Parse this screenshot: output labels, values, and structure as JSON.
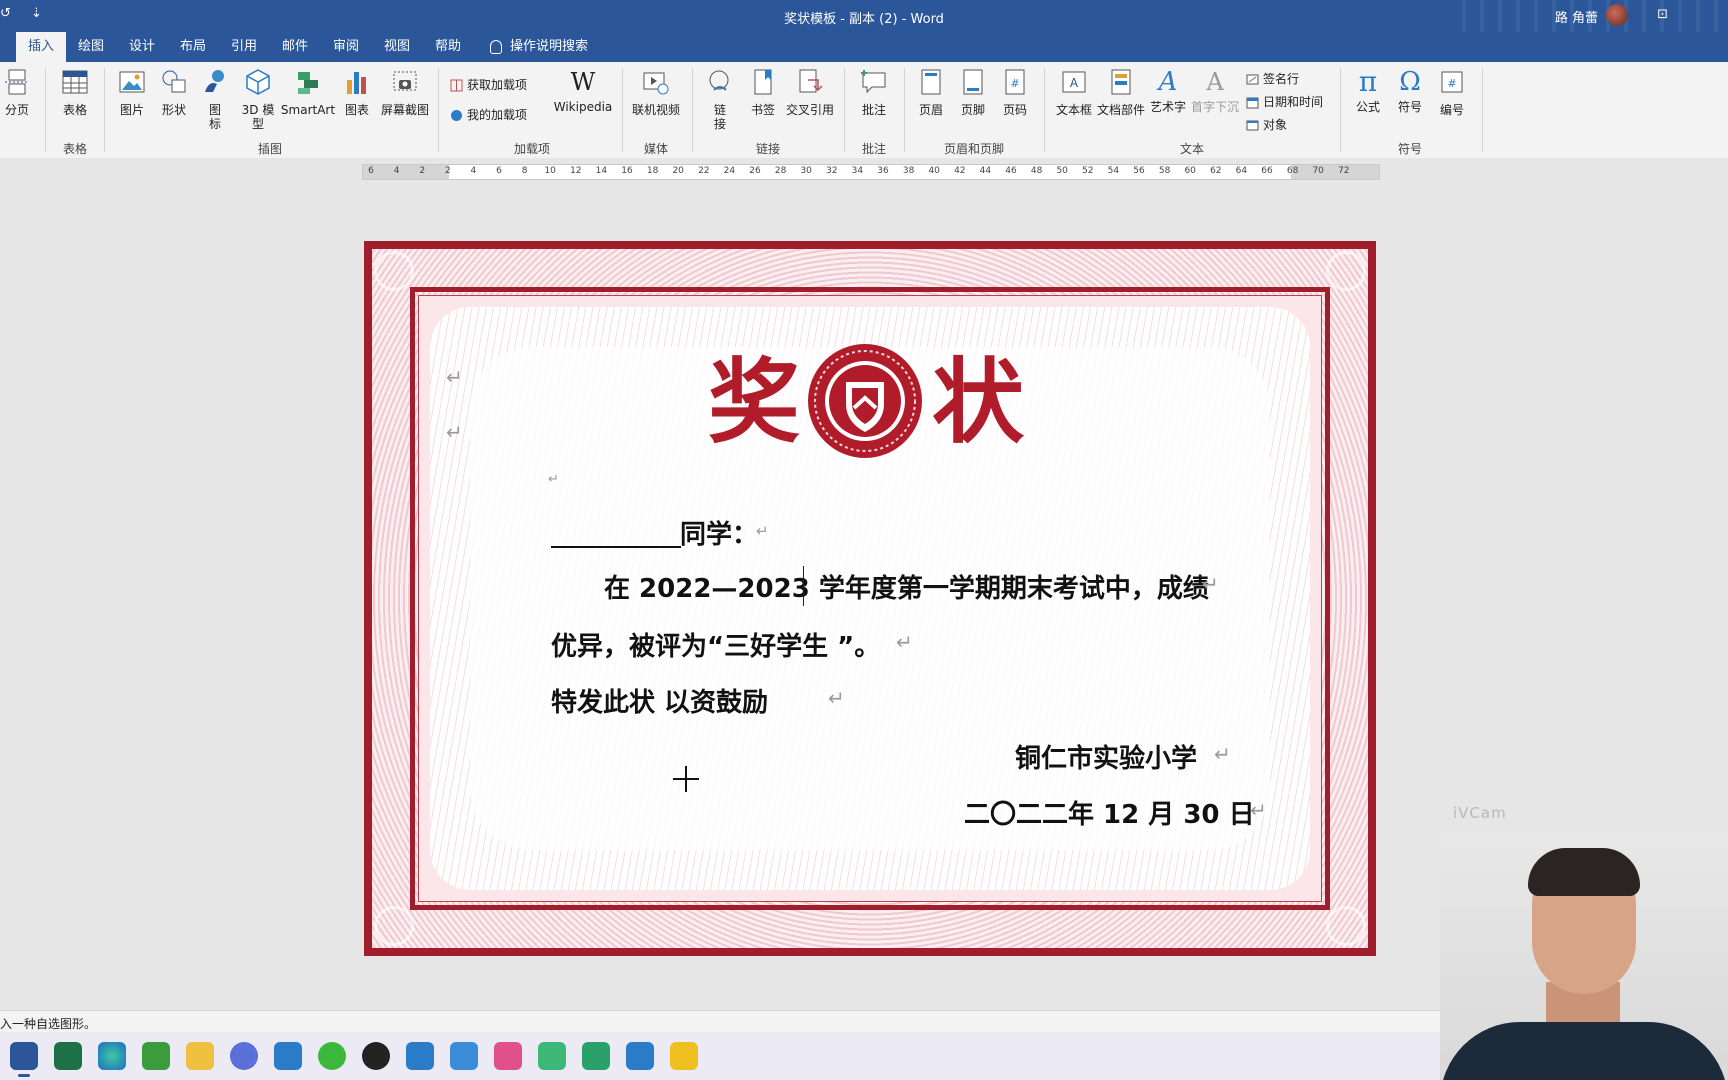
{
  "window": {
    "title": "奖状模板 - 副本 (2)  -  Word",
    "user": "路 角蕾",
    "qa_undo": "↺",
    "qa_more": "⇣",
    "ribbon_display": "⊡"
  },
  "tabs": [
    {
      "label": "插入",
      "active": true
    },
    {
      "label": "绘图"
    },
    {
      "label": "设计"
    },
    {
      "label": "布局"
    },
    {
      "label": "引用"
    },
    {
      "label": "邮件"
    },
    {
      "label": "审阅"
    },
    {
      "label": "视图"
    },
    {
      "label": "帮助"
    },
    {
      "label": "操作说明搜索"
    }
  ],
  "ribbon": {
    "buttons": {
      "page_break": "分页",
      "table": "表格",
      "picture": "图片",
      "shapes": "形状",
      "icons": "图\n标",
      "model3d": "3D 模\n型",
      "smartart": "SmartArt",
      "chart": "图表",
      "screenshot": "屏幕截图",
      "get_addins": "获取加载项",
      "my_addins": "我的加载项",
      "wikipedia": "Wikipedia",
      "online_video": "联机视频",
      "link": "链\n接",
      "bookmark": "书签",
      "cross_ref": "交叉引用",
      "comment": "批注",
      "header": "页眉",
      "footer": "页脚",
      "page_number": "页码",
      "textbox": "文本框",
      "quick_parts": "文档部件",
      "wordart": "艺术字",
      "dropcap": "首字下沉",
      "signature_line": "签名行",
      "date_time": "日期和时间",
      "object": "对象",
      "equation": "公式",
      "symbol": "符号",
      "numbering": "编号"
    },
    "groups": {
      "tables": "表格",
      "illustrations": "插图",
      "addins": "加载项",
      "media": "媒体",
      "links": "链接",
      "comments": "批注",
      "header_footer": "页眉和页脚",
      "text": "文本",
      "symbols": "符号"
    }
  },
  "ruler": {
    "ticks": [
      "6",
      "4",
      "2",
      "2",
      "4",
      "6",
      "8",
      "10",
      "12",
      "14",
      "16",
      "18",
      "20",
      "22",
      "24",
      "26",
      "28",
      "30",
      "32",
      "34",
      "36",
      "38",
      "40",
      "42",
      "44",
      "46",
      "48",
      "50",
      "52",
      "54",
      "56",
      "58",
      "60",
      "62",
      "64",
      "66",
      "68",
      "70",
      "72"
    ]
  },
  "document": {
    "headline_left": "奖",
    "headline_right": "状",
    "para_mark": "↵",
    "line_recipient": "同学：",
    "line_body1": "在 2022—2023 学年度第一学期期末考试中，成绩",
    "line_body2": "优异，被评为“三好学生 ”。",
    "line_body3": "特发此状    以资鼓励",
    "school": "铜仁市实验小学",
    "date": "二〇二二年 12 月 30 日"
  },
  "colors": {
    "word_blue": "#2b579a",
    "certificate_red": "#a01e2c"
  },
  "watermark": "iVCam",
  "status_bar": "入一种自选图形。",
  "taskbar": {
    "apps": [
      "word-icon",
      "excel-icon",
      "edge-icon",
      "camtasia-icon",
      "file-explorer-icon",
      "browser-icon",
      "app-arrow-icon",
      "wechat-icon",
      "qq-icon",
      "calendar-icon",
      "todo-icon",
      "slack-icon",
      "en-icon",
      "app-z-icon",
      "photos-icon",
      "sticky-notes-icon"
    ]
  }
}
